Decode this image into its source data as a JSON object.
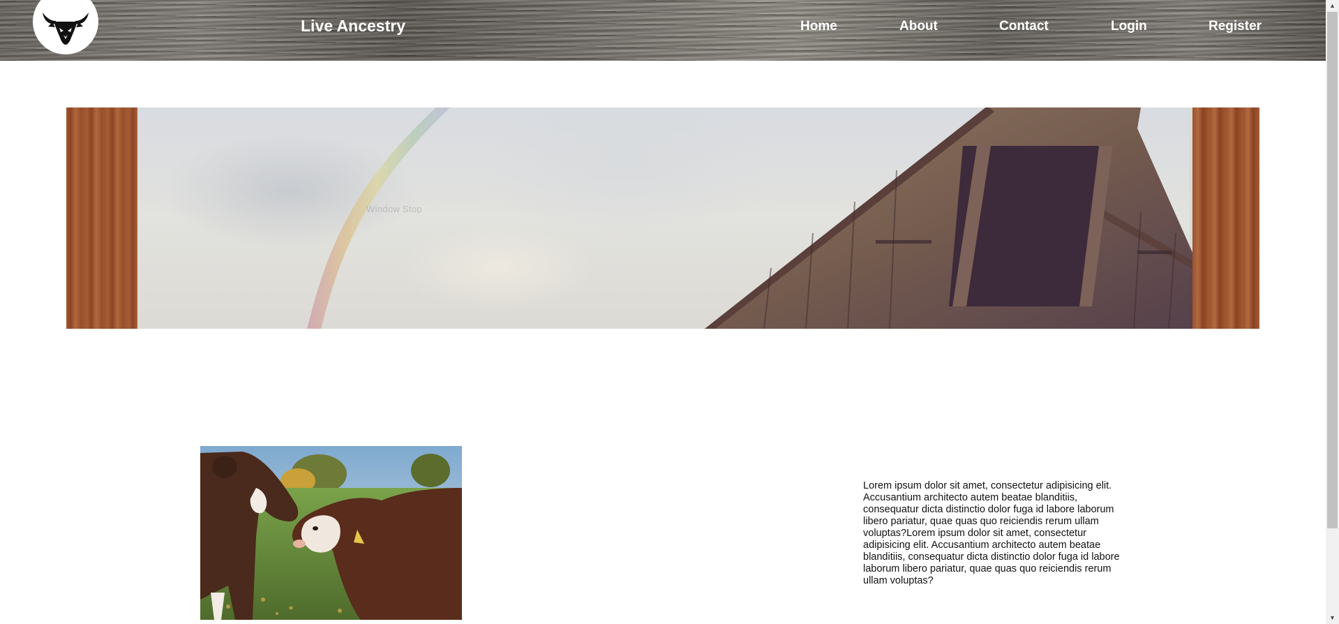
{
  "site": {
    "brand": "Live Ancestry",
    "logo_icon": "bull-head-icon"
  },
  "nav": {
    "items": [
      {
        "label": "Home"
      },
      {
        "label": "About"
      },
      {
        "label": "Contact"
      },
      {
        "label": "Login"
      },
      {
        "label": "Register"
      }
    ]
  },
  "hero": {
    "caption": "Window Stop",
    "image": "barn-rainbow-photo"
  },
  "content": {
    "image": "two-cows-photo",
    "paragraph": "Lorem ipsum dolor sit amet, consectetur adipisicing elit. Accusantium architecto autem beatae blanditiis, consequatur dicta distinctio dolor fuga id labore laborum libero pariatur, quae quas quo reiciendis rerum ullam voluptas?Lorem ipsum dolor sit amet, consectetur adipisicing elit. Accusantium architecto autem beatae blanditiis, consequatur dicta distinctio dolor fuga id labore laborum libero pariatur, quae quas quo reiciendis rerum ullam voluptas?"
  },
  "colors": {
    "nav_text": "#ffffff",
    "body_text": "#111111",
    "frame_wood": "#a55a34"
  }
}
